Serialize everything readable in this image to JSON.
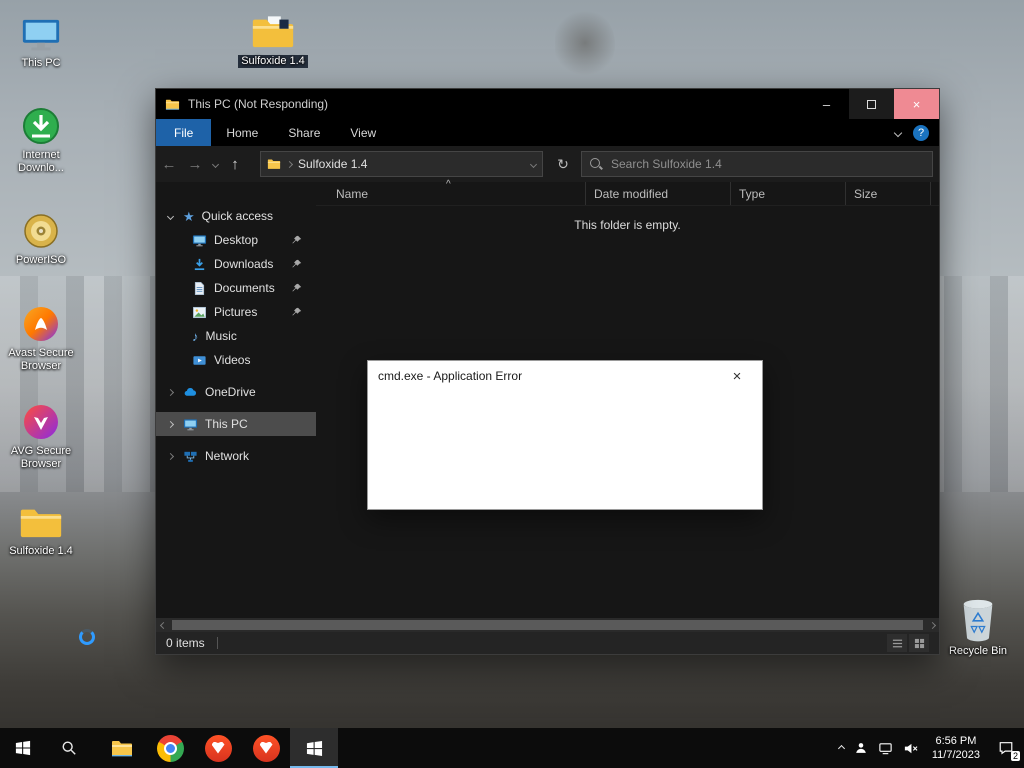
{
  "icons": {
    "back": "←",
    "forward": "→",
    "up": "↑",
    "refresh": "↻",
    "close": "×",
    "minimize": "–",
    "help": "?",
    "star": "★",
    "music": "♪",
    "sort_caret": "^"
  },
  "desktop": {
    "icons": [
      {
        "label": "This PC"
      },
      {
        "label": "Internet Downlo..."
      },
      {
        "label": "PowerISO"
      },
      {
        "label": "Avast Secure Browser"
      },
      {
        "label": "AVG Secure Browser"
      },
      {
        "label": "Sulfoxide 1.4"
      }
    ],
    "top_icon": {
      "label": "Sulfoxide 1.4"
    },
    "recycle_bin": {
      "label": "Recycle Bin"
    }
  },
  "explorer": {
    "title": "This PC (Not Responding)",
    "menu": {
      "items": [
        "File",
        "Home",
        "Share",
        "View"
      ]
    },
    "nav": {
      "address": "Sulfoxide 1.4"
    },
    "search": {
      "placeholder": "Search Sulfoxide 1.4"
    },
    "columns": [
      "Name",
      "Date modified",
      "Type",
      "Size"
    ],
    "empty_message": "This folder is empty.",
    "sidebar": {
      "quick_access": {
        "label": "Quick access",
        "items": [
          "Desktop",
          "Downloads",
          "Documents",
          "Pictures",
          "Music",
          "Videos"
        ]
      },
      "onedrive": "OneDrive",
      "this_pc": "This PC",
      "network": "Network"
    },
    "status": {
      "items_text": "0 items"
    }
  },
  "dialog": {
    "title": "cmd.exe - Application Error"
  },
  "taskbar": {
    "clock": {
      "time": "6:56 PM",
      "date": "11/7/2023"
    },
    "notification_count": "2"
  }
}
